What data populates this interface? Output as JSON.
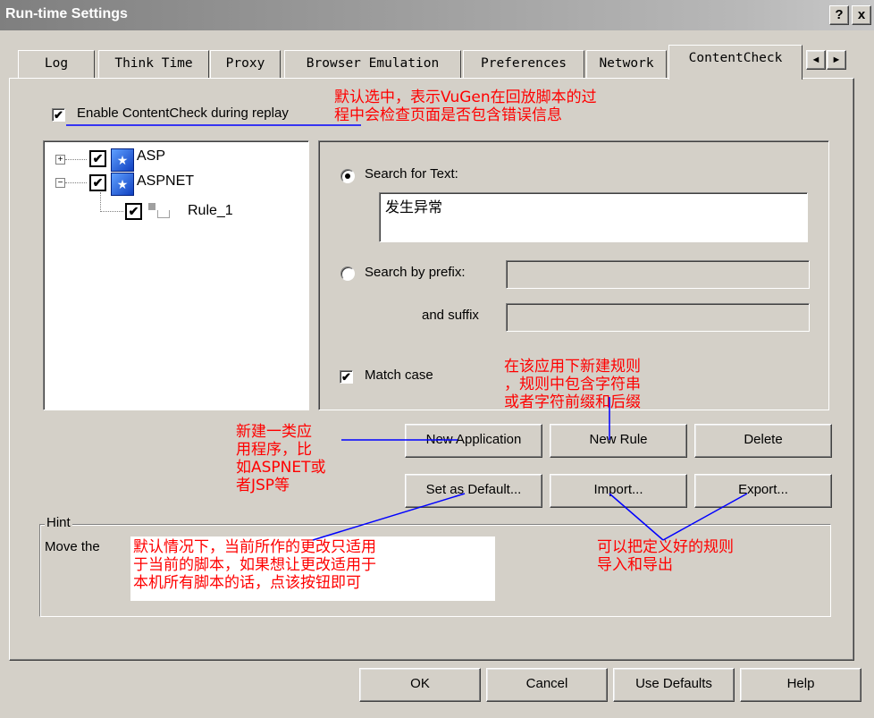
{
  "window": {
    "title": "Run-time Settings",
    "help_btn": "?",
    "close_btn": "x"
  },
  "tabs": [
    "Log",
    "Think Time",
    "Proxy",
    "Browser Emulation",
    "Preferences",
    "Network",
    "ContentCheck"
  ],
  "active_tab": "ContentCheck",
  "tab_scroll": {
    "left": "◄",
    "right": "►"
  },
  "enable_checkbox": {
    "label": "Enable ContentCheck during replay",
    "checked": true
  },
  "tree": {
    "items": [
      {
        "expander": "+",
        "label": "ASP",
        "checked": true
      },
      {
        "expander": "−",
        "label": "ASPNET",
        "checked": true
      },
      {
        "label": "Rule_1",
        "checked": true
      }
    ]
  },
  "search_text": {
    "label": "Search for Text:",
    "value": "发生异常",
    "selected": true
  },
  "search_prefix": {
    "label": "Search by prefix:",
    "value": "",
    "selected": false
  },
  "suffix": {
    "label": "and suffix",
    "value": ""
  },
  "match_case": {
    "label": "Match case",
    "checked": true
  },
  "buttons": {
    "new_application": "New Application",
    "new_rule": "New Rule",
    "delete": "Delete",
    "set_default": "Set as Default...",
    "import": "Import...",
    "export": "Export..."
  },
  "hint": {
    "legend": "Hint",
    "text": "Move the"
  },
  "footer": {
    "ok": "OK",
    "cancel": "Cancel",
    "use_defaults": "Use Defaults",
    "help": "Help"
  },
  "annotations": {
    "enable_note": "默认选中，表示VuGen在回放脚本的过\n程中会检查页面是否包含错误信息",
    "new_rule_note": "在该应用下新建规则\n，规则中包含字符串\n或者字符前缀和后缀",
    "new_app_note": "新建一类应\n用程序，比\n如ASPNET或\n者JSP等",
    "default_note": "默认情况下，当前所作的更改只适用\n于当前的脚本，如果想让更改适用于\n本机所有脚本的话，点该按钮即可",
    "import_export_note": "可以把定义好的规则\n导入和导出"
  },
  "colors": {
    "dialog_bg": "#d4d0c8",
    "annotation": "#ff0000",
    "arrow": "#0000ff"
  }
}
